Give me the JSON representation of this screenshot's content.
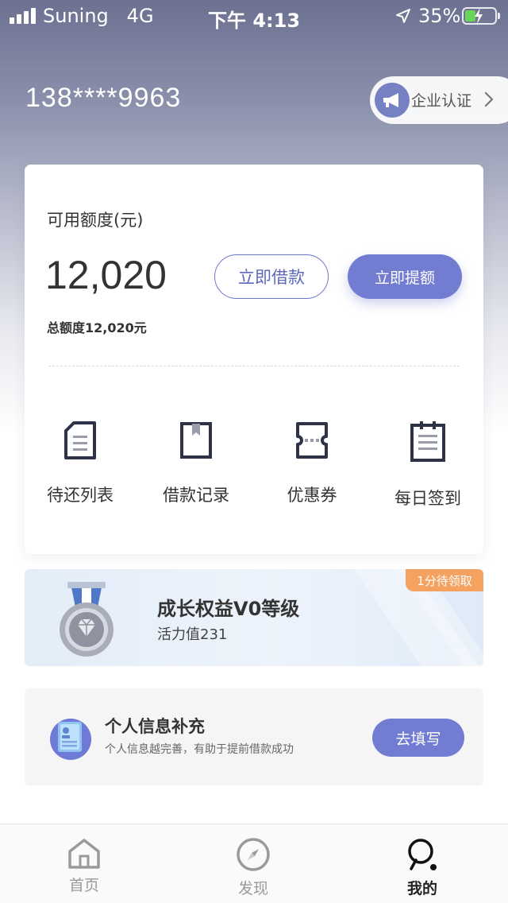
{
  "status_bar": {
    "carrier": "Suning",
    "network": "4G",
    "time": "下午 4:13",
    "battery_percent": "35%",
    "battery_level": 0.35,
    "battery_color": "#6ad35a"
  },
  "header": {
    "phone_number": "138****9963",
    "enterprise_label": "企业认证",
    "enterprise_icon": "megaphone-icon"
  },
  "credit": {
    "available_label": "可用额度(元)",
    "available_value": "12,020",
    "total_label": "总额度12,020元",
    "borrow_label": "立即借款",
    "raise_label": "立即提额",
    "accent_color": "#727dd2"
  },
  "quick_actions": [
    {
      "label": "待还列表",
      "icon": "document-list-icon"
    },
    {
      "label": "借款记录",
      "icon": "bookmark-record-icon"
    },
    {
      "label": "优惠券",
      "icon": "coupon-ticket-icon"
    },
    {
      "label": "每日签到",
      "icon": "calendar-checkin-icon"
    }
  ],
  "growth": {
    "title": "成长权益V0等级",
    "vitality": "活力值231",
    "badge": "1分待领取",
    "badge_color": "#f5a261",
    "icon": "medal-icon"
  },
  "info_card": {
    "title": "个人信息补充",
    "subtitle": "个人信息越完善，有助于提前借款成功",
    "button_label": "去填写",
    "icon": "id-card-icon"
  },
  "tab_bar": {
    "tabs": [
      {
        "label": "首页",
        "icon": "home-icon",
        "active": false
      },
      {
        "label": "发现",
        "icon": "compass-icon",
        "active": false
      },
      {
        "label": "我的",
        "icon": "profile-search-icon",
        "active": true
      }
    ]
  }
}
